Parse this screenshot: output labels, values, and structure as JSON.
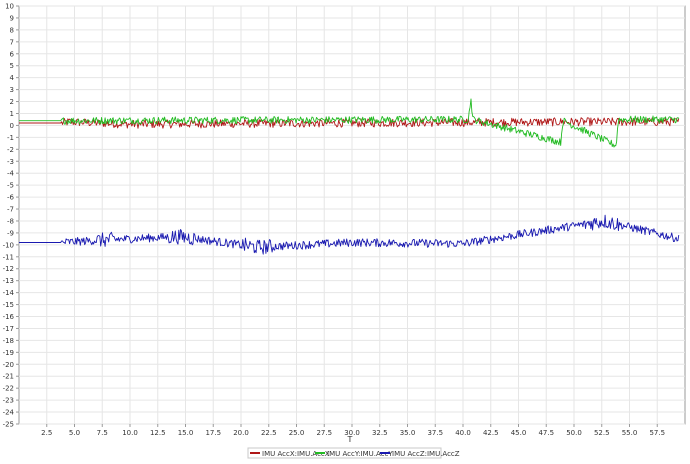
{
  "chart_data": {
    "type": "line",
    "xlabel": "T",
    "ylabel": "",
    "xlim": [
      0,
      60
    ],
    "ylim": [
      -25,
      10
    ],
    "x_ticks": [
      "2.5",
      "5.0",
      "7.5",
      "10.0",
      "12.5",
      "15.0",
      "17.5",
      "20.0",
      "22.5",
      "25.0",
      "27.5",
      "30.0",
      "32.5",
      "35.0",
      "37.5",
      "40.0",
      "42.5",
      "45.0",
      "47.5",
      "50.0",
      "52.5",
      "55.0",
      "57.5"
    ],
    "x_tick_values": [
      2.5,
      5,
      7.5,
      10,
      12.5,
      15,
      17.5,
      20,
      22.5,
      25,
      27.5,
      30,
      32.5,
      35,
      37.5,
      40,
      42.5,
      45,
      47.5,
      50,
      52.5,
      55,
      57.5
    ],
    "y_ticks": [
      "10",
      "9",
      "8",
      "7",
      "6",
      "5",
      "4",
      "3",
      "2",
      "1",
      "0",
      "-1",
      "-2",
      "-3",
      "-4",
      "-5",
      "-6",
      "-7",
      "-8",
      "-9",
      "-10",
      "-11",
      "-12",
      "-13",
      "-14",
      "-15",
      "-16",
      "-17",
      "-18",
      "-19",
      "-20",
      "-21",
      "-22",
      "-23",
      "-24",
      "-25"
    ],
    "y_tick_values": [
      10,
      9,
      8,
      7,
      6,
      5,
      4,
      3,
      2,
      1,
      0,
      -1,
      -2,
      -3,
      -4,
      -5,
      -6,
      -7,
      -8,
      -9,
      -10,
      -11,
      -12,
      -13,
      -14,
      -15,
      -16,
      -17,
      -18,
      -19,
      -20,
      -21,
      -22,
      -23,
      -24,
      -25
    ],
    "grid": true,
    "legend_position": "bottom",
    "series": [
      {
        "name": "IMU AccX:IMU.AccX",
        "color": "#b01818",
        "baseline": 0.2,
        "amplitude": 0.35,
        "x": [
          0,
          3.8,
          4.5,
          10,
          20,
          30,
          40,
          50,
          55,
          59.5
        ],
        "y": [
          0.2,
          0.2,
          0.3,
          0.1,
          0.15,
          0.2,
          0.25,
          0.3,
          0.3,
          0.3
        ]
      },
      {
        "name": "IMU AccY:IMU.AccY",
        "color": "#22bb22",
        "baseline": 0.45,
        "amplitude": 0.3,
        "x": [
          0,
          3.8,
          40.5,
          40.7,
          40.9,
          48.8,
          49.0,
          53.8,
          54.0,
          59.5
        ],
        "y": [
          0.4,
          0.4,
          0.5,
          2.3,
          0.5,
          -1.4,
          0.4,
          -1.7,
          0.5,
          0.5
        ]
      },
      {
        "name": "IMU AccZ:IMU.AccZ",
        "color": "#1a1ab0",
        "baseline": -9.8,
        "amplitude": 0.35,
        "x": [
          0,
          3.8,
          7.5,
          14.5,
          21.5,
          30,
          40,
          52.7,
          59.5
        ],
        "y": [
          -9.8,
          -9.8,
          -9.6,
          -9.3,
          -10.2,
          -9.8,
          -9.9,
          -8.0,
          -9.5
        ]
      }
    ]
  }
}
